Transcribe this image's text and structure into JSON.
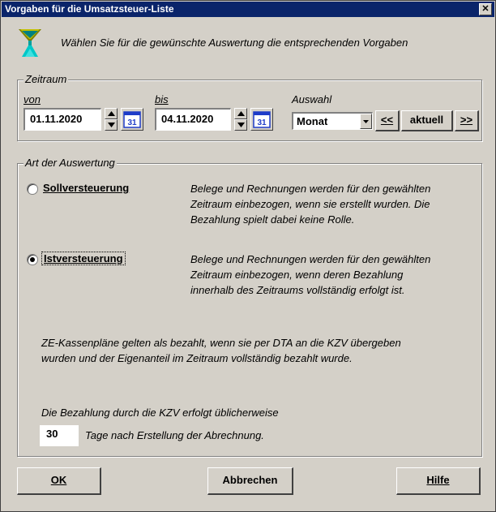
{
  "window": {
    "title": "Vorgaben für die Umsatzsteuer-Liste",
    "close_glyph": "✕"
  },
  "header": {
    "intro": "Wählen Sie für die gewünschte Auswertung die entsprechenden Vorgaben"
  },
  "zeitraum": {
    "legend": "Zeitraum",
    "von_label": "von",
    "von_value": "01.11.2020",
    "bis_label": "bis",
    "bis_value": "04.11.2020",
    "calendar_day": "31",
    "auswahl_label": "Auswahl",
    "auswahl_value": "Monat",
    "prev_label": "<<",
    "current_label": "aktuell",
    "next_label": ">>"
  },
  "auswertung": {
    "legend": "Art der Auswertung",
    "options": [
      {
        "label": "Sollversteuerung",
        "selected": false,
        "desc": [
          "Belege und Rechnungen werden für den gewählten",
          "Zeitraum einbezogen, wenn sie erstellt wurden. Die",
          "Bezahlung spielt dabei keine Rolle."
        ]
      },
      {
        "label": "Istversteuerung",
        "selected": true,
        "desc": [
          "Belege und Rechnungen werden für den gewählten",
          "Zeitraum einbezogen, wenn deren Bezahlung",
          "innerhalb des Zeitraums vollständig erfolgt ist."
        ]
      }
    ],
    "note": [
      "ZE-Kassenpläne gelten als bezahlt, wenn sie per DTA an die KZV übergeben",
      "wurden und der Eigenanteil im Zeitraum vollständig bezahlt wurde."
    ],
    "kzv_text": "Die Bezahlung durch die KZV erfolgt üblicherweise",
    "days_value": "30",
    "days_suffix": "Tage nach Erstellung der Abrechnung."
  },
  "buttons": {
    "ok": "OK",
    "cancel": "Abbrechen",
    "help": "Hilfe"
  },
  "colors": {
    "titlebar": "#0a246a",
    "face": "#d4d0c8",
    "calendar_blue": "#1e3cc8"
  },
  "icons": {
    "header": "filter-funnel-icon",
    "calendar": "calendar-icon"
  }
}
